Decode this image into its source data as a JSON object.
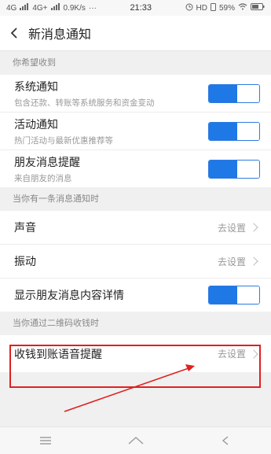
{
  "status_bar": {
    "carrier1": "4G",
    "carrier2": "4G+",
    "speed": "0.9K/s",
    "dots": "···",
    "time": "21:33",
    "hd": "HD",
    "battery": "59%"
  },
  "header": {
    "title": "新消息通知"
  },
  "sections": [
    {
      "header": "你希望收到"
    },
    {
      "header": "当你有一条消息通知时"
    },
    {
      "header": "当你通过二维码收钱时"
    }
  ],
  "toggles": [
    {
      "title": "系统通知",
      "subtitle": "包含还款、转账等系统服务和资金变动",
      "on": true
    },
    {
      "title": "活动通知",
      "subtitle": "热门活动与最新优惠推荐等",
      "on": true
    },
    {
      "title": "朋友消息提醒",
      "subtitle": "来自朋友的消息",
      "on": true
    }
  ],
  "links": [
    {
      "title": "声音",
      "action": "去设置"
    },
    {
      "title": "振动",
      "action": "去设置"
    }
  ],
  "detail_toggle": {
    "title": "显示朋友消息内容详情",
    "on": true
  },
  "voice_row": {
    "title": "收钱到账语音提醒",
    "action": "去设置"
  },
  "colors": {
    "accent": "#1e78e6",
    "annotation": "#e02020"
  }
}
